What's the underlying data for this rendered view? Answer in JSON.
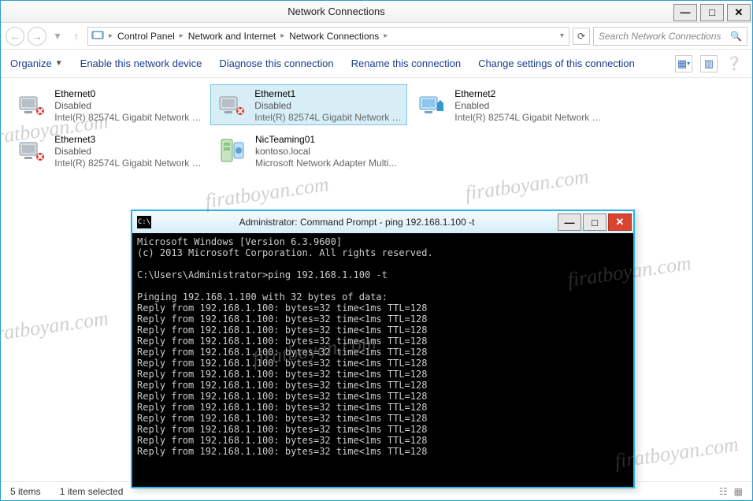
{
  "window": {
    "title": "Network Connections"
  },
  "breadcrumb": {
    "seg1": "Control Panel",
    "seg2": "Network and Internet",
    "seg3": "Network Connections"
  },
  "search": {
    "placeholder": "Search Network Connections"
  },
  "toolbar": {
    "organize": "Organize",
    "disable": "Enable this network device",
    "diagnose": "Diagnose this connection",
    "rename": "Rename this connection",
    "change": "Change settings of this connection"
  },
  "connections": [
    {
      "name": "Ethernet0",
      "status": "Disabled",
      "desc": "Intel(R) 82574L Gigabit Network C..."
    },
    {
      "name": "Ethernet1",
      "status": "Disabled",
      "desc": "Intel(R) 82574L Gigabit Network C..."
    },
    {
      "name": "Ethernet2",
      "status": "Enabled",
      "desc": "Intel(R) 82574L Gigabit Network C..."
    },
    {
      "name": "Ethernet3",
      "status": "Disabled",
      "desc": "Intel(R) 82574L Gigabit Network C..."
    },
    {
      "name": "NicTeaming01",
      "status": "kontoso.local",
      "desc": "Microsoft Network Adapter Multi..."
    }
  ],
  "statusbar": {
    "count": "5 items",
    "selected": "1 item selected"
  },
  "cmd": {
    "title": "Administrator: Command Prompt - ping  192.168.1.100 -t",
    "lines": [
      "Microsoft Windows [Version 6.3.9600]",
      "(c) 2013 Microsoft Corporation. All rights reserved.",
      "",
      "C:\\Users\\Administrator>ping 192.168.1.100 -t",
      "",
      "Pinging 192.168.1.100 with 32 bytes of data:",
      "Reply from 192.168.1.100: bytes=32 time<1ms TTL=128",
      "Reply from 192.168.1.100: bytes=32 time<1ms TTL=128",
      "Reply from 192.168.1.100: bytes=32 time<1ms TTL=128",
      "Reply from 192.168.1.100: bytes=32 time<1ms TTL=128",
      "Reply from 192.168.1.100: bytes=32 time<1ms TTL=128",
      "Reply from 192.168.1.100: bytes=32 time<1ms TTL=128",
      "Reply from 192.168.1.100: bytes=32 time<1ms TTL=128",
      "Reply from 192.168.1.100: bytes=32 time<1ms TTL=128",
      "Reply from 192.168.1.100: bytes=32 time<1ms TTL=128",
      "Reply from 192.168.1.100: bytes=32 time<1ms TTL=128",
      "Reply from 192.168.1.100: bytes=32 time<1ms TTL=128",
      "Reply from 192.168.1.100: bytes=32 time<1ms TTL=128",
      "Reply from 192.168.1.100: bytes=32 time<1ms TTL=128",
      "Reply from 192.168.1.100: bytes=32 time<1ms TTL=128"
    ]
  },
  "watermark": "firatboyan.com"
}
